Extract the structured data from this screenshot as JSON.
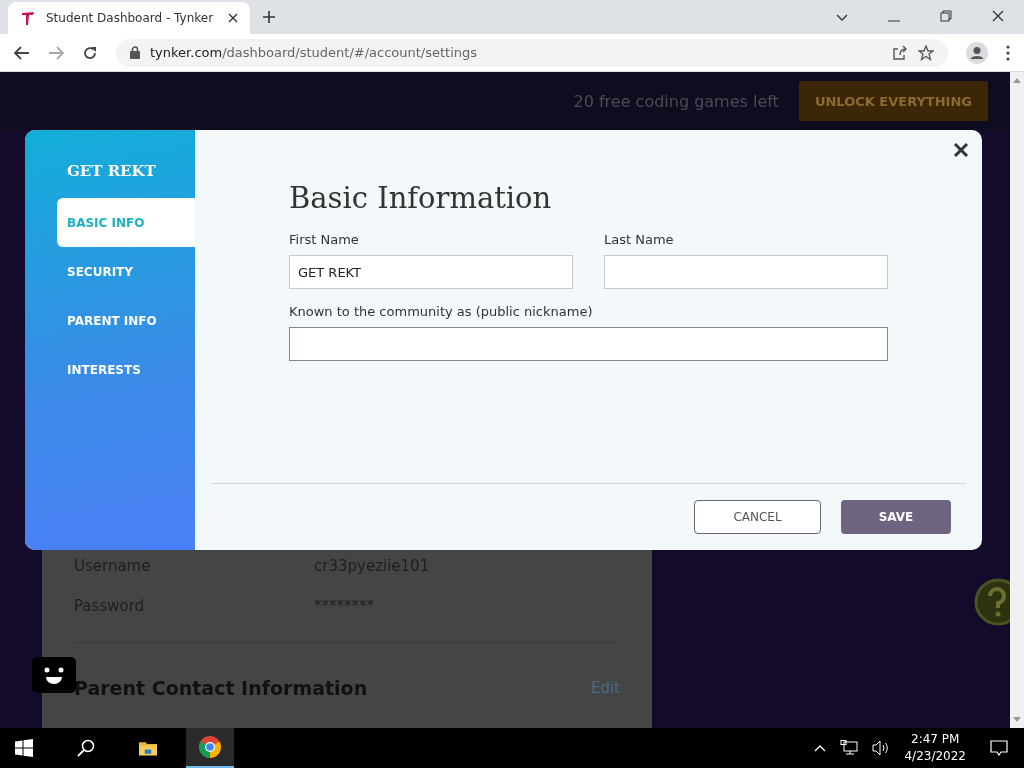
{
  "browser": {
    "tab_title": "Student Dashboard - Tynker",
    "url_host": "tynker.com",
    "url_path": "/dashboard/student/#/account/settings"
  },
  "page": {
    "promo_text": "20 free coding games left",
    "unlock_button": "UNLOCK EVERYTHING",
    "account_rows": [
      {
        "label": "Username",
        "value": "cr33pyeziie101"
      },
      {
        "label": "Password",
        "value": "********"
      }
    ],
    "section_title": "Parent Contact Information",
    "edit_link": "Edit"
  },
  "modal": {
    "sidebar": {
      "title": "GET REKT",
      "items": [
        {
          "label": "BASIC INFO",
          "selected": true
        },
        {
          "label": "SECURITY",
          "selected": false
        },
        {
          "label": "PARENT INFO",
          "selected": false
        },
        {
          "label": "INTERESTS",
          "selected": false
        }
      ]
    },
    "title": "Basic Information",
    "fields": [
      {
        "label": "First Name",
        "value": "GET REKT",
        "kind": "half"
      },
      {
        "label": "Last Name",
        "kind": "half"
      },
      {
        "label": "Known to the community as (public nickname)",
        "kind": "full"
      }
    ],
    "cancel_button": "CANCEL",
    "save_button": "SAVE"
  },
  "taskbar": {
    "time": "2:47 PM",
    "date": "4/23/2022"
  }
}
